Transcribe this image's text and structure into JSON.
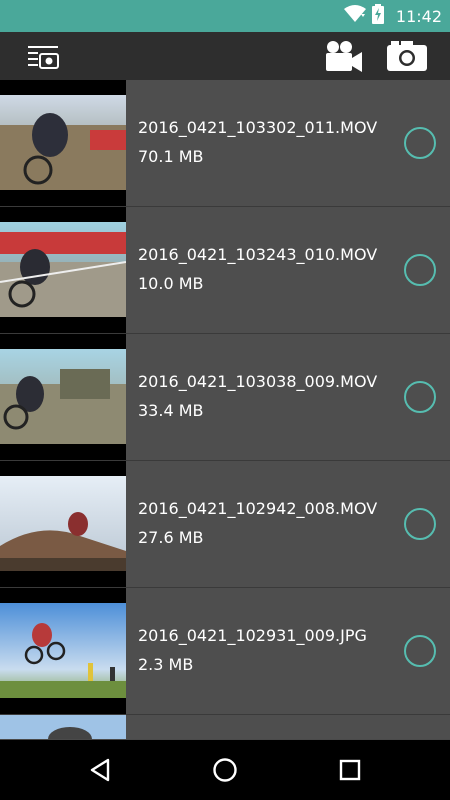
{
  "status_bar": {
    "time": "11:42",
    "icons": [
      "wifi-icon",
      "battery-charging-icon"
    ],
    "color": "#4aa89a"
  },
  "toolbar": {
    "left_icon": "camera-menu-icon",
    "right_icons": [
      "video-camera-icon",
      "photo-camera-icon"
    ]
  },
  "files": [
    {
      "name": "2016_0421_103302_011.MOV",
      "size": "70.1 MB"
    },
    {
      "name": "2016_0421_103243_010.MOV",
      "size": "10.0 MB"
    },
    {
      "name": "2016_0421_103038_009.MOV",
      "size": "33.4 MB"
    },
    {
      "name": "2016_0421_102942_008.MOV",
      "size": "27.6 MB"
    },
    {
      "name": "2016_0421_102931_009.JPG",
      "size": "2.3 MB"
    }
  ],
  "nav_bar": {
    "icons": [
      "back-icon",
      "home-icon",
      "recents-icon"
    ]
  },
  "accent_color": "#56bdb0"
}
